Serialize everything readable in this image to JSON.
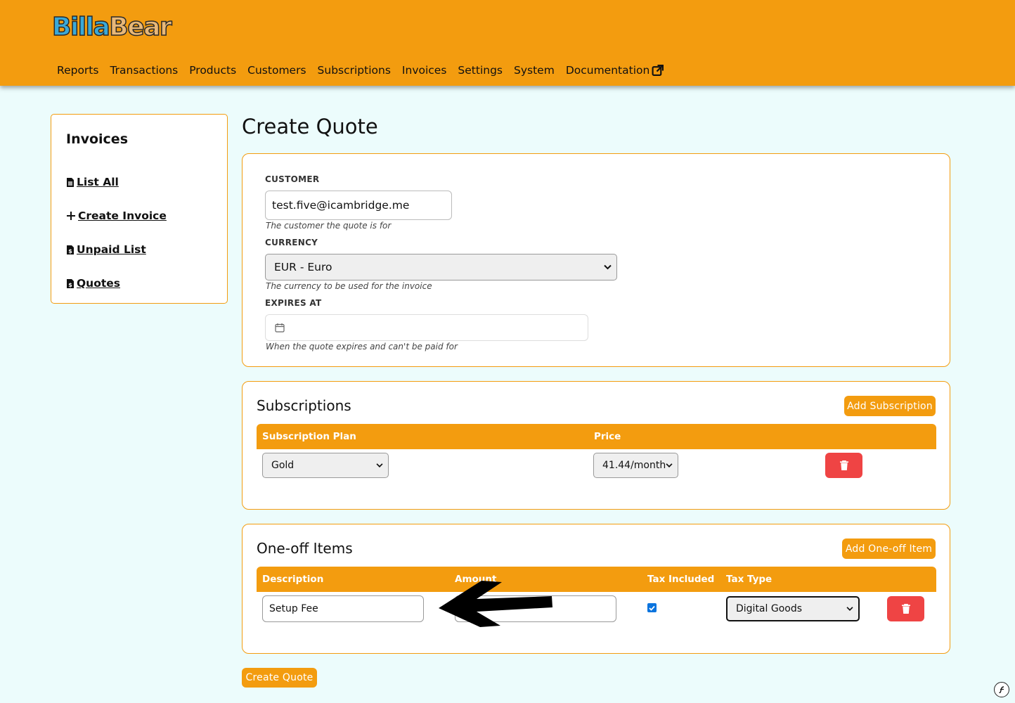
{
  "brand": {
    "part1": "Billa",
    "part2": "Bear"
  },
  "nav": {
    "items": [
      "Reports",
      "Transactions",
      "Products",
      "Customers",
      "Subscriptions",
      "Invoices",
      "Settings",
      "System",
      "Documentation"
    ]
  },
  "sidebar": {
    "title": "Invoices",
    "links": [
      {
        "label": "List All",
        "icon": "file-lines-icon"
      },
      {
        "label": "Create Invoice",
        "icon": "plus-icon"
      },
      {
        "label": "Unpaid List",
        "icon": "file-invoice-dollar-icon"
      },
      {
        "label": "Quotes",
        "icon": "file-invoice-dollar-icon"
      }
    ]
  },
  "page": {
    "title": "Create Quote"
  },
  "form": {
    "customer": {
      "label": "CUSTOMER",
      "value": "test.five@icambridge.me",
      "help": "The customer the quote is for"
    },
    "currency": {
      "label": "CURRENCY",
      "value": "EUR - Euro",
      "help": "The currency to be used for the invoice"
    },
    "expires_at": {
      "label": "EXPIRES AT",
      "value": "",
      "help": "When the quote expires and can't be paid for"
    }
  },
  "subscriptions": {
    "title": "Subscriptions",
    "add_button": "Add Subscription",
    "columns": [
      "Subscription Plan",
      "Price"
    ],
    "rows": [
      {
        "plan": "Gold",
        "price": "41.44/month"
      }
    ]
  },
  "one_off": {
    "title": "One-off Items",
    "add_button": "Add One-off Item",
    "columns": [
      "Description",
      "Amount",
      "Tax Included",
      "Tax Type"
    ],
    "rows": [
      {
        "description": "Setup Fee",
        "amount": "",
        "tax_included": true,
        "tax_type": "Digital Goods"
      }
    ]
  },
  "submit_button": "Create Quote",
  "colors": {
    "accent": "#f39c0f",
    "danger": "#ef4444",
    "background": "#ecfcfc"
  }
}
